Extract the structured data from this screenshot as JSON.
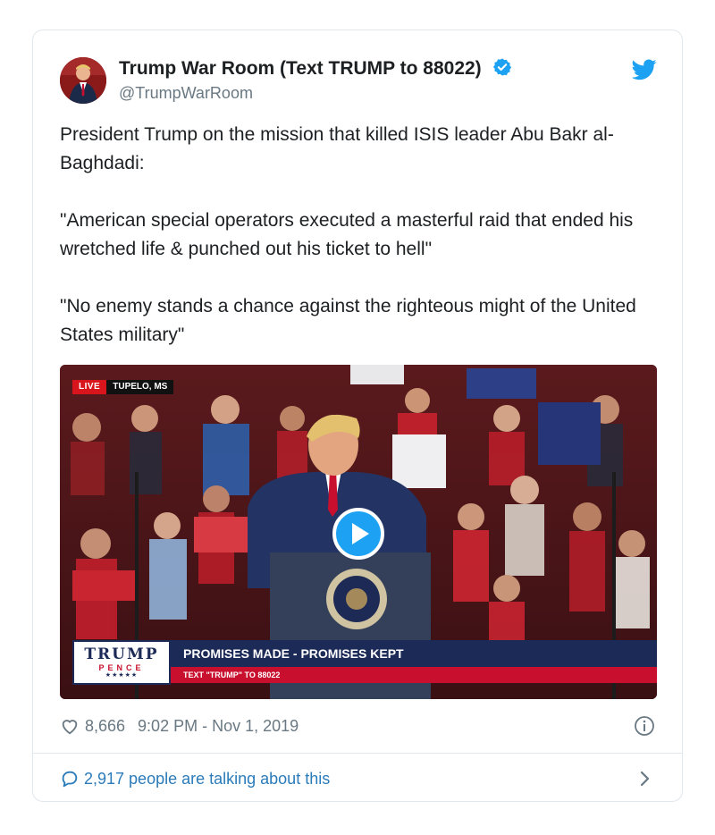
{
  "author": {
    "display_name": "Trump War Room (Text TRUMP to 88022)",
    "handle": "@TrumpWarRoom",
    "verified": true,
    "avatar_icon": "profile-photo"
  },
  "brand": {
    "icon": "twitter-bird-icon",
    "color": "#1da1f2"
  },
  "tweet": {
    "paragraphs": [
      "President Trump on the mission that killed ISIS leader Abu Bakr al-Baghdadi:",
      "\"American special operators executed a masterful raid that ended his wretched life & punched out his ticket to hell\"",
      "\"No enemy stands a chance against the righteous might of the United States military\""
    ]
  },
  "video": {
    "live_label": "LIVE",
    "location": "TUPELO, MS",
    "chyron_logo_line1": "TRUMP",
    "chyron_logo_line2": "PENCE",
    "chyron_logo_stars": "★★★★★",
    "chyron_headline": "PROMISES MADE - PROMISES KEPT",
    "chyron_sub": "TEXT \"TRUMP\" TO 88022",
    "play_icon": "play-icon"
  },
  "footer": {
    "likes": "8,666",
    "timestamp": "9:02 PM - Nov 1, 2019",
    "conversation": "2,917 people are talking about this"
  },
  "colors": {
    "link": "#2b7bb9",
    "muted": "#697882",
    "navy": "#1b2a57",
    "red": "#c8102e"
  }
}
